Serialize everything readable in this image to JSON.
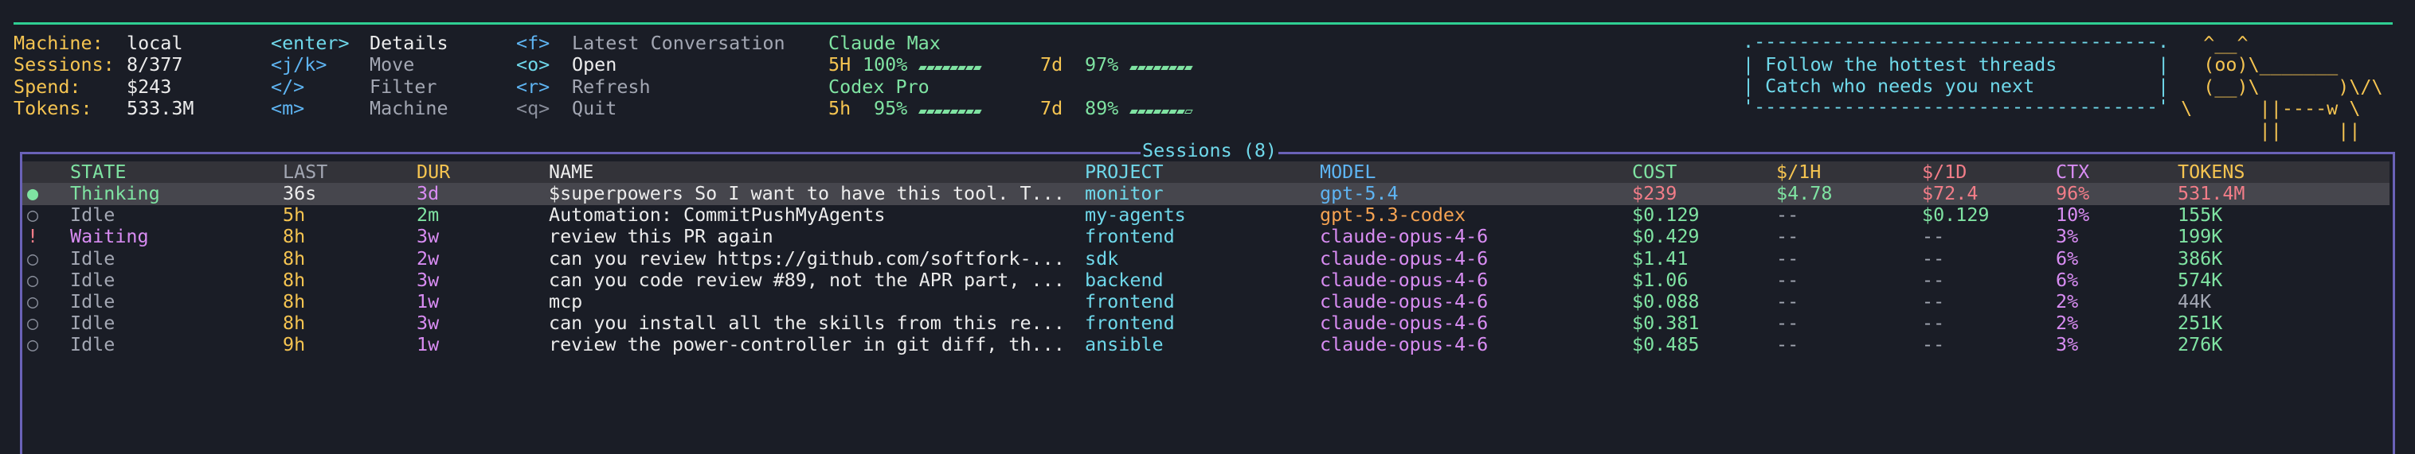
{
  "summary": {
    "machine": {
      "label": "Machine:",
      "value": "local"
    },
    "sessions": {
      "label": "Sessions:",
      "value": "8/377"
    },
    "spend": {
      "label": "Spend:",
      "value": "$243"
    },
    "tokens": {
      "label": "Tokens:",
      "value": "533.3M"
    }
  },
  "keys_col1": [
    {
      "key": "<enter>",
      "label": "Details"
    },
    {
      "key": "<j/k>",
      "label": "Move"
    },
    {
      "key": "</>",
      "label": "Filter"
    },
    {
      "key": "<m>",
      "label": "Machine"
    }
  ],
  "keys_col2": [
    {
      "key": "<f>",
      "label": "Latest Conversation"
    },
    {
      "key": "<o>",
      "label": "Open"
    },
    {
      "key": "<r>",
      "label": "Refresh"
    },
    {
      "key": "<q>",
      "label": "Quit"
    }
  ],
  "plans": [
    {
      "name": "Claude Max",
      "windows": [
        {
          "label": "5H",
          "pct": "100%",
          "value": 100
        },
        {
          "label": "7d",
          "pct": "97%",
          "value": 97
        }
      ]
    },
    {
      "name": "Codex Pro",
      "windows": [
        {
          "label": "5h",
          "pct": "95%",
          "value": 95
        },
        {
          "label": "7d",
          "pct": "89%",
          "value": 89
        }
      ]
    }
  ],
  "sticker": {
    "lines": [
      "Follow the hottest threads",
      "Catch who needs you next"
    ],
    "art": [
      "   ^__^",
      "   (oo)\\_______",
      "   (__)\\       )\\/\\",
      " \\      ||----w \\",
      "        ||     ||"
    ]
  },
  "sessions": {
    "title": "Sessions (8)",
    "columns": [
      "STATE",
      "LAST",
      "DUR",
      "NAME",
      "PROJECT",
      "MODEL",
      "COST",
      "$/1H",
      "$/1D",
      "CTX",
      "TOKENS"
    ],
    "rows": [
      {
        "icon": "●",
        "state": "Thinking",
        "last": "36s",
        "dur": "3d",
        "name": "$superpowers So I want to have this tool. T...",
        "project": "monitor",
        "model": "gpt-5.4",
        "cost": "$239",
        "per_hour": "$4.78",
        "per_day": "$72.4",
        "ctx": "96%",
        "tokens": "531.4M",
        "selected": true
      },
      {
        "icon": "○",
        "state": "Idle",
        "last": "5h",
        "dur": "2m",
        "name": "Automation: CommitPushMyAgents",
        "project": "my-agents",
        "model": "gpt-5.3-codex",
        "cost": "$0.129",
        "per_hour": "--",
        "per_day": "$0.129",
        "ctx": "10%",
        "tokens": "155K"
      },
      {
        "icon": "!",
        "state": "Waiting",
        "last": "8h",
        "dur": "3w",
        "name": "review this PR again",
        "project": "frontend",
        "model": "claude-opus-4-6",
        "cost": "$0.429",
        "per_hour": "--",
        "per_day": "--",
        "ctx": "3%",
        "tokens": "199K"
      },
      {
        "icon": "○",
        "state": "Idle",
        "last": "8h",
        "dur": "2w",
        "name": "can you review https://github.com/softfork-...",
        "project": "sdk",
        "model": "claude-opus-4-6",
        "cost": "$1.41",
        "per_hour": "--",
        "per_day": "--",
        "ctx": "6%",
        "tokens": "386K"
      },
      {
        "icon": "○",
        "state": "Idle",
        "last": "8h",
        "dur": "3w",
        "name": "can you code review #89, not the APR part, ...",
        "project": "backend",
        "model": "claude-opus-4-6",
        "cost": "$1.06",
        "per_hour": "--",
        "per_day": "--",
        "ctx": "6%",
        "tokens": "574K"
      },
      {
        "icon": "○",
        "state": "Idle",
        "last": "8h",
        "dur": "1w",
        "name": "mcp",
        "project": "frontend",
        "model": "claude-opus-4-6",
        "cost": "$0.088",
        "per_hour": "--",
        "per_day": "--",
        "ctx": "2%",
        "tokens": "44K"
      },
      {
        "icon": "○",
        "state": "Idle",
        "last": "8h",
        "dur": "3w",
        "name": "can you install all the skills from this re...",
        "project": "frontend",
        "model": "claude-opus-4-6",
        "cost": "$0.381",
        "per_hour": "--",
        "per_day": "--",
        "ctx": "2%",
        "tokens": "251K"
      },
      {
        "icon": "○",
        "state": "Idle",
        "last": "9h",
        "dur": "1w",
        "name": "review the power-controller in git diff, th...",
        "project": "ansible",
        "model": "claude-opus-4-6",
        "cost": "$0.485",
        "per_hour": "--",
        "per_day": "--",
        "ctx": "3%",
        "tokens": "276K"
      }
    ]
  },
  "colors": {
    "accent_line": "#2fcf93",
    "panel_border": "#6a62b8",
    "background": "#1a1d26"
  }
}
